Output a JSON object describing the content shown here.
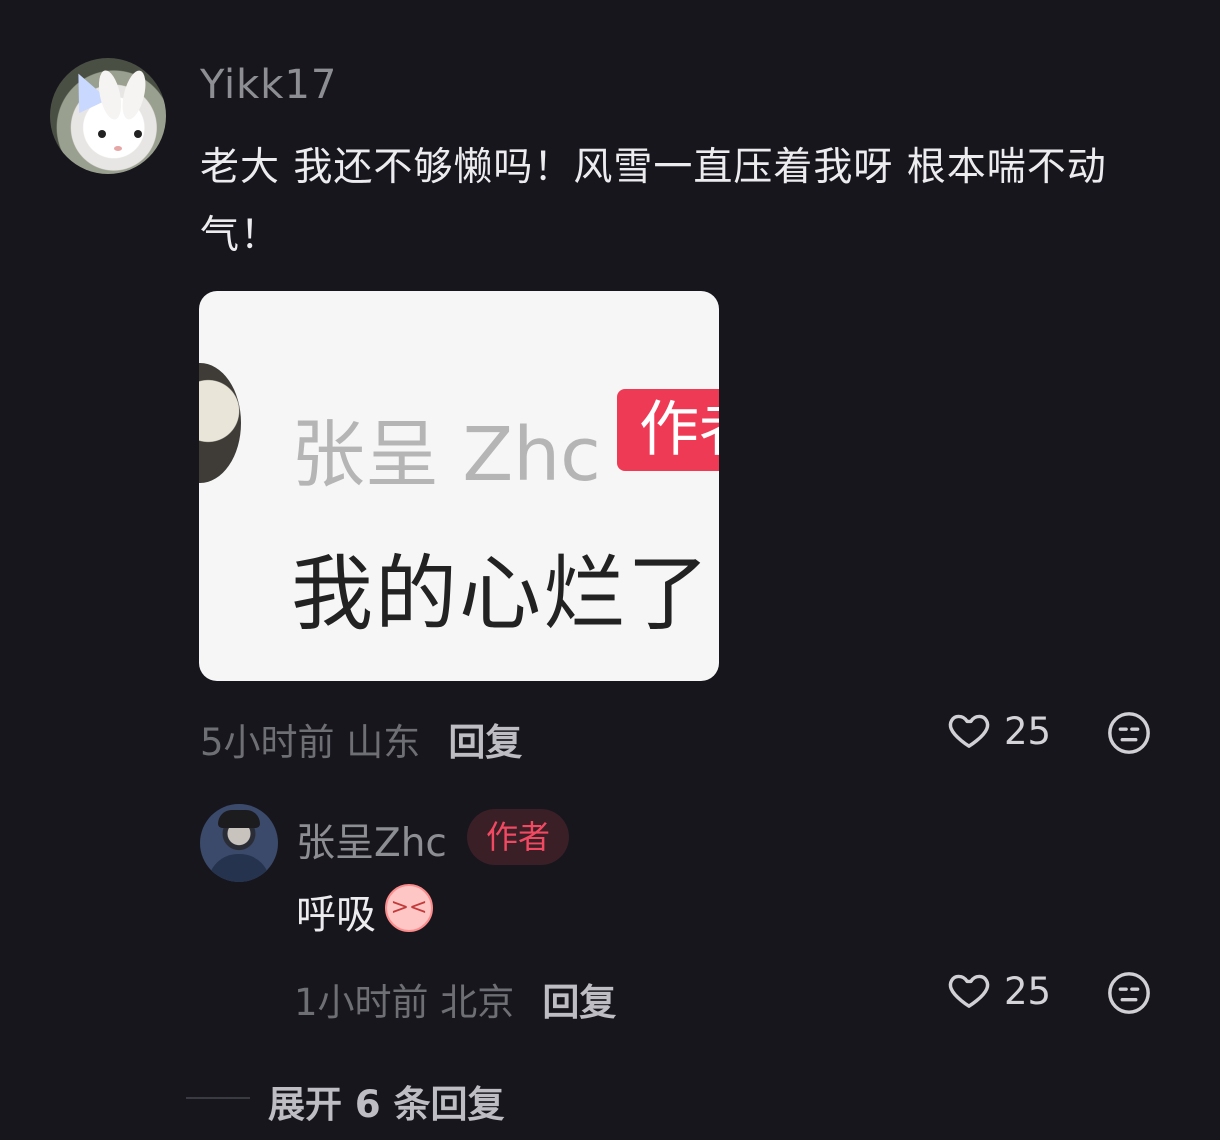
{
  "comment": {
    "username": "Yikk17",
    "text": "老大 我还不够懒吗！风雪一直压着我呀 根本喘不动气！",
    "image": {
      "name": "张呈 Zhc",
      "badge": "作者",
      "text": "我的心烂了"
    },
    "time_location": "5小时前 山东",
    "reply_label": "回复",
    "likes": "25"
  },
  "reply": {
    "username": "张呈Zhc",
    "badge": "作者",
    "text": "呼吸",
    "time_location": "1小时前 北京",
    "reply_label": "回复",
    "likes": "25"
  },
  "expand": {
    "label": "展开 6 条回复"
  },
  "colors": {
    "background": "#17161d",
    "accent": "#f24963"
  }
}
